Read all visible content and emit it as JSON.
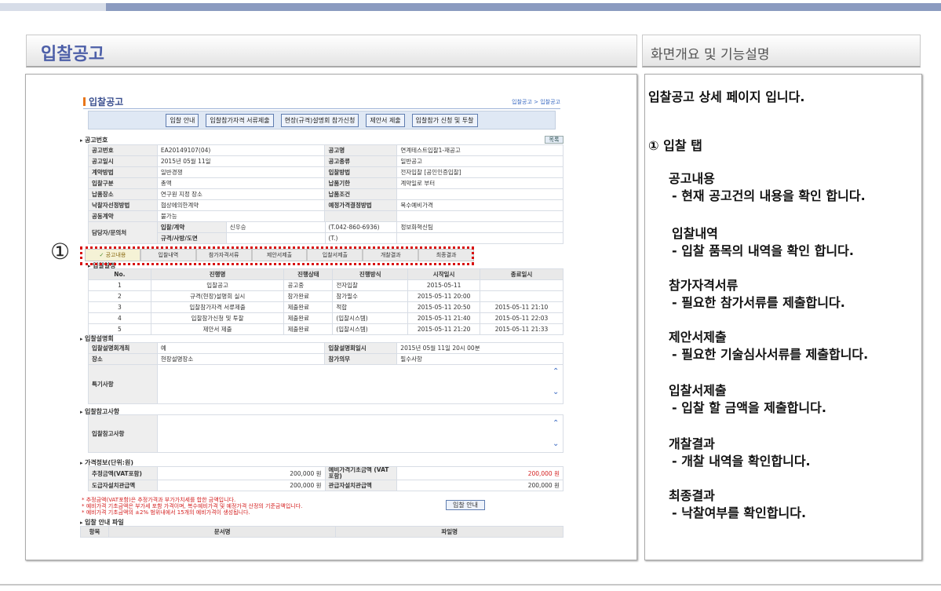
{
  "header": {
    "title": "입찰공고",
    "desc_title": "화면개요 및 기능설명"
  },
  "screenshot": {
    "title": "입찰공고",
    "breadcrumb": "입찰공고 > 입찰공고",
    "buttons": [
      "입찰 안내",
      "입찰참가자격 서류제출",
      "현장(규격)설명회 참가신청",
      "제안서 제출",
      "입찰참가 신청 및 투찰"
    ],
    "section_notice": "공고번호",
    "list_button": "목록",
    "info_rows": [
      [
        "공고번호",
        "EA20149107(04)",
        "공고명",
        "연계테스트입찰1-재공고"
      ],
      [
        "공고일시",
        "2015년 05월 11일",
        "공고종류",
        "일반공고"
      ],
      [
        "계약방법",
        "일반경쟁",
        "입찰방법",
        "전자입찰 [공인인증입찰]"
      ],
      [
        "입찰구분",
        "총액",
        "납품기한",
        "계약일로 부터"
      ],
      [
        "납품장소",
        "연구원 지정 장소",
        "납품조건",
        ""
      ],
      [
        "낙찰자선정방법",
        "협상에의한계약",
        "예정가격결정방법",
        "복수예비가격"
      ],
      [
        "공동계약",
        "불가능",
        "",
        ""
      ]
    ],
    "contact_label": "담당자/문의처",
    "contact_rows": [
      [
        "입찰/계약",
        "신우승",
        "(T.042-860-6936)",
        "정보화혁신팀"
      ],
      [
        "규격/사방/도면",
        "",
        "(T.)",
        ""
      ]
    ],
    "marker": "①",
    "tabs": [
      "공고내용",
      "입찰내역",
      "참가자격서류",
      "제안서제출",
      "입찰서제출",
      "개찰결과",
      "최종결과"
    ],
    "tab_active_check": "✓",
    "section_progress": "입찰일정",
    "progress_headers": [
      "No.",
      "진행명",
      "진행상태",
      "진행방식",
      "시작일시",
      "종료일시"
    ],
    "progress_rows": [
      [
        "1",
        "입찰공고",
        "공고중",
        "전자입찰",
        "2015-05-11",
        ""
      ],
      [
        "2",
        "규격(현장)설명회 실시",
        "참가완료",
        "참가필수",
        "2015-05-11 20:00",
        ""
      ],
      [
        "3",
        "입찰참가자격 서류제출",
        "제출완료",
        "적합",
        "2015-05-11 20:50",
        "2015-05-11 21:10"
      ],
      [
        "4",
        "입찰참가신청 및 투찰",
        "제출완료",
        "(입찰시스템)",
        "2015-05-11 21:40",
        "2015-05-11 22:03"
      ],
      [
        "5",
        "제안서 제출",
        "제출완료",
        "(입찰시스템)",
        "2015-05-11 21:20",
        "2015-05-11 21:33"
      ]
    ],
    "section_briefing": "입찰설명회",
    "briefing_rows": [
      [
        "입찰설명회개최",
        "예",
        "입찰설명회일시",
        "2015년 05월 11일 20시 00분"
      ],
      [
        "장소",
        "현장설명장소",
        "참가의무",
        "필수사항"
      ]
    ],
    "special_label": "특기사항",
    "section_reference": "입찰참고사항",
    "reference_label": "입찰참고사항",
    "scroll_up": "⌃",
    "scroll_down": "⌄",
    "section_price": "가격정보(단위:원)",
    "price_rows": [
      [
        "추정금액(VAT포함)",
        "200,000 원",
        "예비가격기초금액 (VAT포함)",
        "200,000 원"
      ],
      [
        "도급자설치관급액",
        "200,000 원",
        "관급자설치관급액",
        "200,000 원"
      ]
    ],
    "notes": [
      "* 추정금액(VAT포함)은 추정가격과 부가가치세를 합한 금액입니다.",
      "* 예비가격 기초금액은 부가세 포함 가격이며, 복수예비가격 및 예정가격 산정의 기준금액입니다.",
      "* 예비가격 기초금액의 ±2% 범위내에서 15개의 예비가격이 생성됩니다."
    ],
    "guide_button": "입찰 안내",
    "section_files": "입찰 안내 파일",
    "file_headers": [
      "항목",
      "문서명",
      "파일명"
    ]
  },
  "description": {
    "intro": "입찰공고 상세 페이지 입니다.",
    "tab_heading": "① 입찰 탭",
    "items": [
      {
        "title": "공고내용",
        "detail": "- 현재 공고건의 내용을 확인 합니다."
      },
      {
        "title": "입찰내역",
        "detail": "- 입찰 품목의 내역을 확인 합니다."
      },
      {
        "title": "참가자격서류",
        "detail": "- 필요한 참가서류를 제출합니다."
      },
      {
        "title": "제안서제출",
        "detail": "- 필요한 기술심사서류를 제출합니다."
      },
      {
        "title": "입찰서제출",
        "detail": "- 입찰 할 금액을 제출합니다."
      },
      {
        "title": "개찰결과",
        "detail": "- 개찰 내역을 확인합니다."
      },
      {
        "title": "최종결과",
        "detail": "- 낙찰여부를 확인합니다."
      }
    ]
  }
}
